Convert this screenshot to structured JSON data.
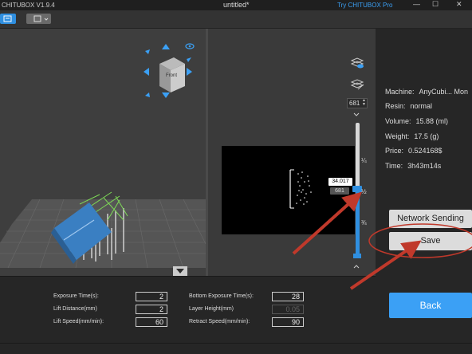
{
  "titlebar": {
    "app_title": "CHITUBOX V1.9.4",
    "document": "untitled*",
    "pro_link": "Try CHITUBOX Pro",
    "min": "—",
    "max": "☐",
    "close": "✕"
  },
  "viewcube": {
    "face_label": "Front"
  },
  "slice": {
    "layer_value": "681",
    "tooltip_value": "34.017",
    "layer_label": "681",
    "fractions": [
      "¼",
      "½",
      "¾"
    ],
    "slider_progress": 0.5
  },
  "info": {
    "machine_label": "Machine:",
    "machine_value": "AnyCubi... Mon",
    "resin_label": "Resin:",
    "resin_value": "normal",
    "volume_label": "Volume:",
    "volume_value": "15.88  (ml)",
    "weight_label": "Weight:",
    "weight_value": "17.5  (g)",
    "price_label": "Price:",
    "price_value": "0.524168$",
    "time_label": "Time:",
    "time_value": "3h43m14s"
  },
  "buttons": {
    "network_sending": "Network Sending",
    "save": "Save",
    "back": "Back"
  },
  "settings": {
    "exposure_label": "Exposure Time(s):",
    "exposure_value": "2",
    "lift_dist_label": "Lift Distance(mm)",
    "lift_dist_value": "2",
    "lift_speed_label": "Lift Speed(mm/min):",
    "lift_speed_value": "60",
    "bottom_exp_label": "Bottom Exposure Time(s):",
    "bottom_exp_value": "28",
    "layer_height_label": "Layer Height(mm)",
    "layer_height_value": "0.05",
    "retract_label": "Retract Speed(mm/min):",
    "retract_value": "90"
  },
  "colors": {
    "accent": "#2f8fe0",
    "annotation": "#c0392b",
    "model_blue": "#3a7fc2",
    "support_green": "#7ed957"
  }
}
